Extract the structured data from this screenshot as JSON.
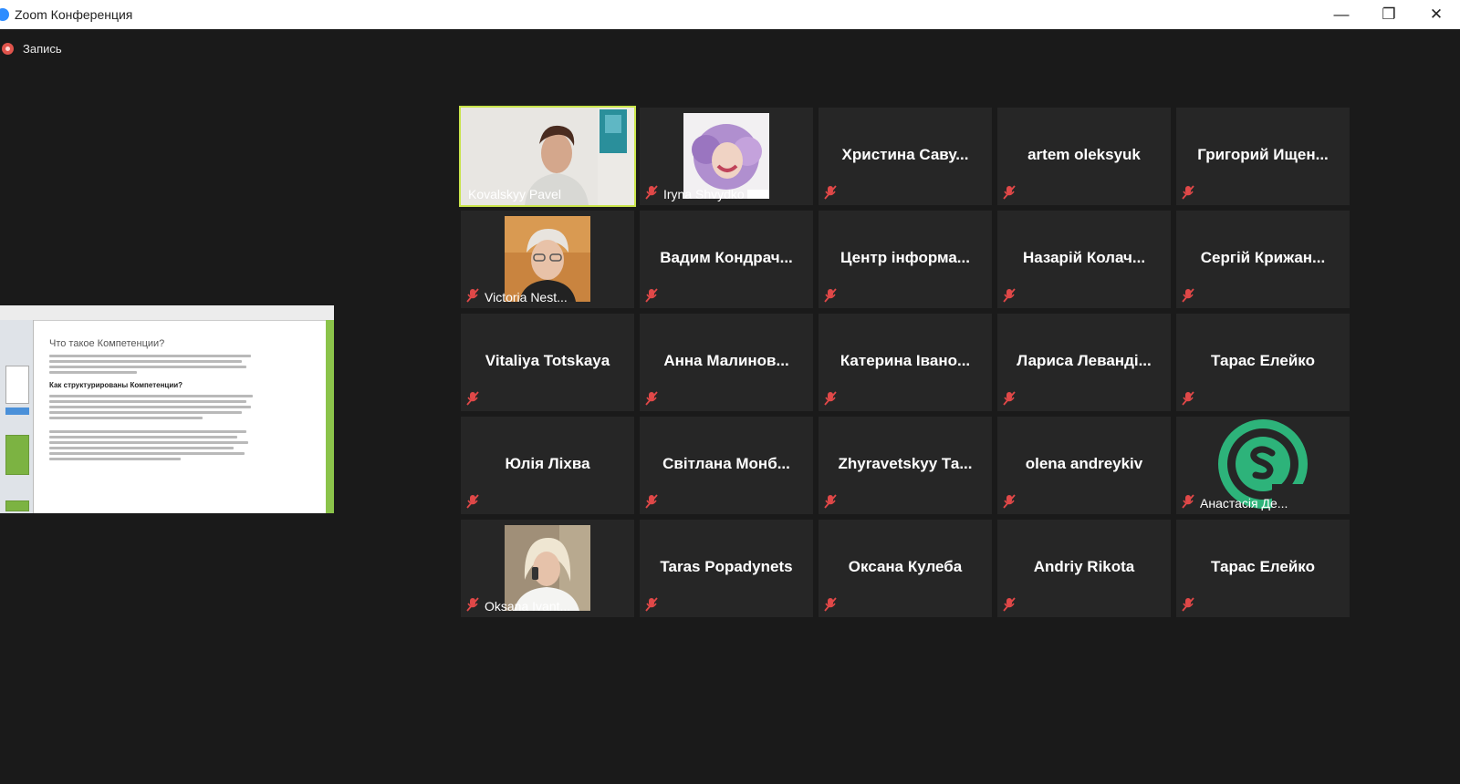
{
  "window": {
    "title": "Zoom Конференция",
    "controls": {
      "minimize": "—",
      "maximize": "❐",
      "close": "✕"
    }
  },
  "recording": {
    "label": "Запись",
    "color": "#e0544c"
  },
  "shared_screen": {
    "heading": "Что такое Компетенции?",
    "subheading": "Как структурированы Компетенции?"
  },
  "colors": {
    "active_speaker": "#c9e44a",
    "mute_icon": "#e04848",
    "tile_bg": "#262626"
  },
  "participants": [
    {
      "name": "Kovalskyy Pavel",
      "video": "man-photo",
      "active": true,
      "muted": false
    },
    {
      "name": "Iryna Shvydko",
      "video": "woman-curly-photo",
      "muted": true
    },
    {
      "name": "Христина Саву..."
    },
    {
      "name": "artem oleksyuk"
    },
    {
      "name": "Григорий Ищен..."
    },
    {
      "name": "Victoria Nest...",
      "video": "woman-glasses-photo",
      "muted": true
    },
    {
      "name": "Вадим Кондрач..."
    },
    {
      "name": "Центр інформа..."
    },
    {
      "name": "Назарій Колач..."
    },
    {
      "name": "Сергій Крижан..."
    },
    {
      "name": "Vitaliya Totskaya"
    },
    {
      "name": "Анна Малинов..."
    },
    {
      "name": "Катерина Івано..."
    },
    {
      "name": "Лариса Леванді..."
    },
    {
      "name": "Тарас Елейко"
    },
    {
      "name": "Юлія Ліхва"
    },
    {
      "name": "Світлана Монб..."
    },
    {
      "name": "Zhyravetskyy Та..."
    },
    {
      "name": "olena andreykiv"
    },
    {
      "name": "Анастасія Де...",
      "video": "green-s-logo",
      "muted": true
    },
    {
      "name": "Oksana Ivant...",
      "video": "woman-phone-photo",
      "muted": true
    },
    {
      "name": "Taras Popadynets"
    },
    {
      "name": "Оксана Кулеба"
    },
    {
      "name": "Andriy Rikota"
    },
    {
      "name": "Тарас Елейко"
    }
  ]
}
